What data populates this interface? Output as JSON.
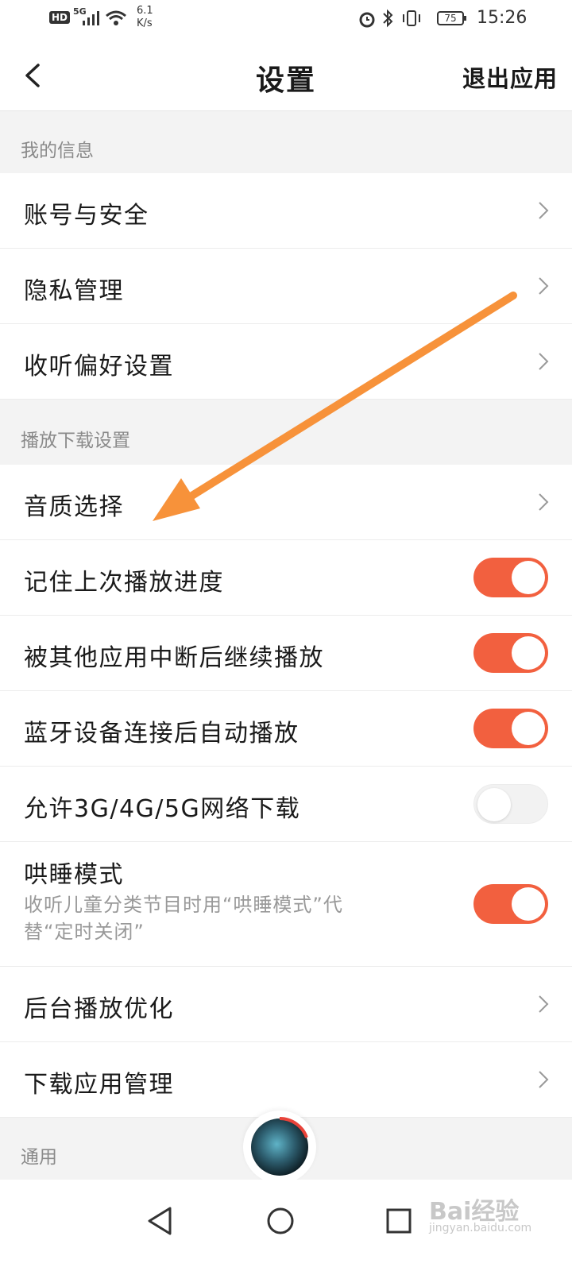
{
  "status_bar": {
    "hd": "HD",
    "network": "5G",
    "net_speed_value": "6.1",
    "net_speed_unit": "K/s",
    "battery": "75",
    "time": "15:26"
  },
  "header": {
    "title": "设置",
    "exit_label": "退出应用"
  },
  "sections": {
    "my_info": "我的信息",
    "playback": "播放下载设置",
    "general": "通用"
  },
  "my_info_items": [
    {
      "label": "账号与安全"
    },
    {
      "label": "隐私管理"
    },
    {
      "label": "收听偏好设置"
    }
  ],
  "playback_items": {
    "sound_quality": "音质选择",
    "remember_progress": {
      "label": "记住上次播放进度",
      "on": true
    },
    "resume_after_interrupt": {
      "label": "被其他应用中断后继续播放",
      "on": true
    },
    "bluetooth_autoplay": {
      "label": "蓝牙设备连接后自动播放",
      "on": true
    },
    "mobile_download": {
      "label": "允许3G/4G/5G网络下载",
      "on": false
    },
    "sleep_mode": {
      "label": "哄睡模式",
      "desc_line1": "收听儿童分类节目时用“哄睡模式”代",
      "desc_line2": "替“定时关闭”",
      "on": true
    },
    "background_optimize": "后台播放优化",
    "download_manager": "下载应用管理"
  },
  "watermark": {
    "brand": "Bai经验",
    "url": "jingyan.baidu.com"
  },
  "colors": {
    "accent": "#f2603f",
    "annotation_arrow": "#f7923a",
    "section_bg": "#f3f3f3"
  }
}
